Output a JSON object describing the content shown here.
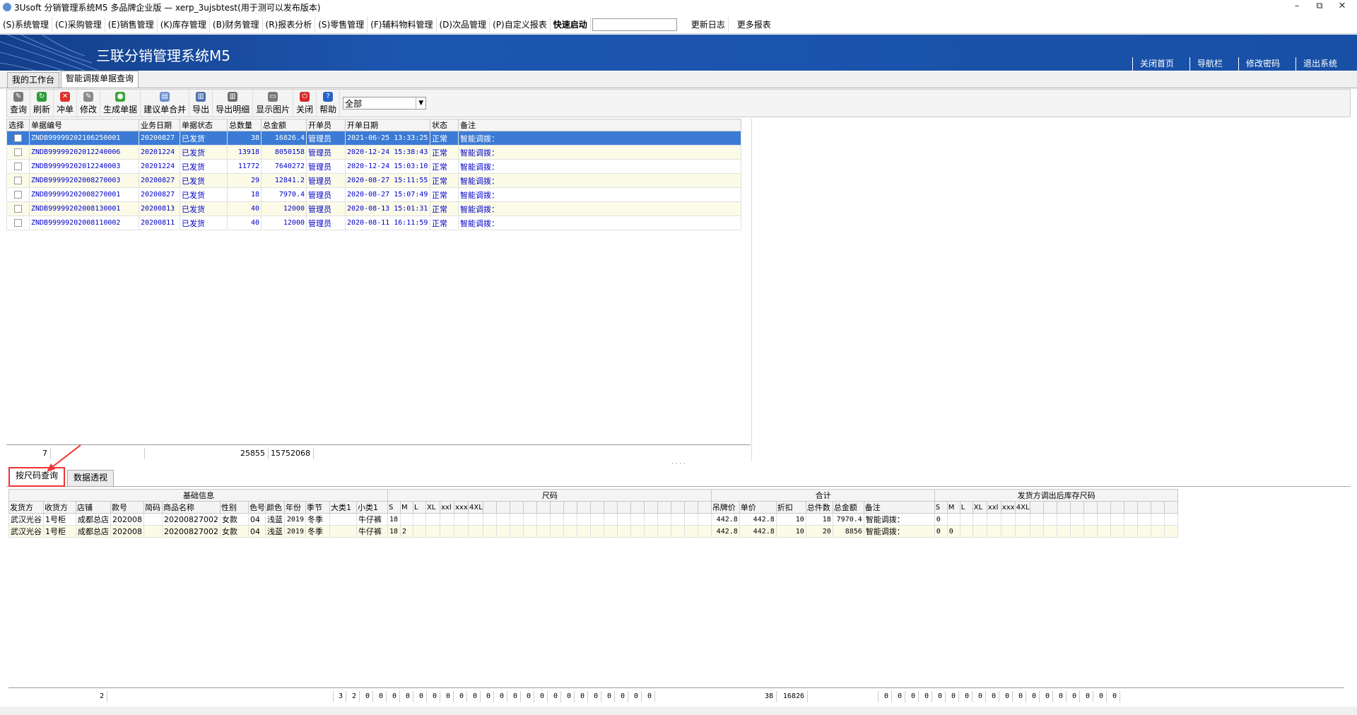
{
  "window": {
    "title": "3Usoft 分销管理系统M5 多品牌企业版 — xerp_3ujsbtest(用于测可以发布版本)",
    "controls": [
      "–",
      "⧉",
      "✕"
    ]
  },
  "menu": {
    "items": [
      "(S)系统管理",
      "(C)采购管理",
      "(E)销售管理",
      "(K)库存管理",
      "(B)财务管理",
      "(R)报表分析",
      "(S)零售管理",
      "(F)辅料物料管理",
      "(D)次品管理",
      "(P)自定义报表"
    ],
    "quick_label": "快速启动",
    "quick_value": "",
    "extra": [
      "更新日志",
      "更多报表"
    ]
  },
  "banner": {
    "title": "三联分销管理系统M5",
    "links": [
      "关闭首页",
      "导航栏",
      "修改密码",
      "退出系统"
    ]
  },
  "tabs": [
    "我的工作台",
    "智能调拨单据查询"
  ],
  "toolbar": {
    "buttons": [
      {
        "label": "查询",
        "icon": "search-icon",
        "color": "#7a7a7a"
      },
      {
        "label": "刷新",
        "icon": "refresh-icon",
        "color": "#2e9a3a"
      },
      {
        "label": "冲单",
        "icon": "cancel-icon",
        "color": "#e0302c"
      },
      {
        "label": "修改",
        "icon": "edit-icon",
        "color": "#8a8a8a"
      },
      {
        "label": "生成单据",
        "icon": "generate-icon",
        "color": "#3aa63a"
      },
      {
        "label": "建议单合并",
        "icon": "merge-icon",
        "color": "#6a8fd0"
      },
      {
        "label": "导出",
        "icon": "export-icon",
        "color": "#4a6fb0"
      },
      {
        "label": "导出明细",
        "icon": "export-detail-icon",
        "color": "#6a6a6a"
      },
      {
        "label": "显示图片",
        "icon": "image-icon",
        "color": "#7a7a7a"
      },
      {
        "label": "关闭",
        "icon": "power-icon",
        "color": "#d82828"
      },
      {
        "label": "帮助",
        "icon": "help-icon",
        "color": "#2a62c8"
      }
    ],
    "filter_value": "全部"
  },
  "grid1": {
    "columns": [
      "选择",
      "单据编号",
      "业务日期",
      "单据状态",
      "总数量",
      "总金额",
      "开单员",
      "开单日期",
      "状态",
      "备注"
    ],
    "rows": [
      [
        "",
        "ZNDB99999202106250001",
        "20200827",
        "已发货",
        "38",
        "16826.4",
        "管理员",
        "2021-06-25 13:33:25",
        "正常",
        "智能调拨："
      ],
      [
        "",
        "ZNDB99999202012240006",
        "20201224",
        "已发货",
        "13918",
        "8050158",
        "管理员",
        "2020-12-24 15:38:43",
        "正常",
        "智能调拨："
      ],
      [
        "",
        "ZNDB99999202012240003",
        "20201224",
        "已发货",
        "11772",
        "7640272",
        "管理员",
        "2020-12-24 15:03:10",
        "正常",
        "智能调拨："
      ],
      [
        "",
        "ZNDB99999202008270003",
        "20200827",
        "已发货",
        "29",
        "12841.2",
        "管理员",
        "2020-08-27 15:11:55",
        "正常",
        "智能调拨："
      ],
      [
        "",
        "ZNDB99999202008270001",
        "20200827",
        "已发货",
        "18",
        "7970.4",
        "管理员",
        "2020-08-27 15:07:49",
        "正常",
        "智能调拨："
      ],
      [
        "",
        "ZNDB99999202008130001",
        "20200813",
        "已发货",
        "40",
        "12000",
        "管理员",
        "2020-08-13 15:01:31",
        "正常",
        "智能调拨："
      ],
      [
        "",
        "ZNDB99999202008110002",
        "20200811",
        "已发货",
        "40",
        "12000",
        "管理员",
        "2020-08-11 16:11:59",
        "正常",
        "智能调拨："
      ]
    ],
    "summary": [
      "7",
      "",
      "25855",
      "15752068"
    ]
  },
  "subtabs": [
    "按尺码查询",
    "数据透视"
  ],
  "grid2": {
    "groups": [
      "基础信息",
      "尺码",
      "合计",
      "发货方调出后库存尺码"
    ],
    "base_columns": [
      "发货方",
      "收货方",
      "店铺",
      "款号",
      "简码",
      "商品名称",
      "性别",
      "色号",
      "颜色",
      "年份",
      "季节",
      "大类1",
      "小类1"
    ],
    "size_columns": [
      "S",
      "M",
      "L",
      "XL",
      "xxl",
      "xxx",
      "4XL"
    ],
    "total_columns": [
      "吊牌价",
      "单价",
      "折扣",
      "总件数",
      "总金额",
      "备注"
    ],
    "stock_columns": [
      "S",
      "M",
      "L",
      "XL",
      "xxl",
      "xxx",
      "4XL"
    ],
    "rows": [
      {
        "base": [
          "武汉光谷",
          "1号柜",
          "成都总店",
          "202008",
          "",
          "20200827002",
          "女款",
          "04",
          "浅蓝",
          "2019",
          "冬季",
          "",
          "牛仔裤"
        ],
        "sizes": [
          "18",
          "",
          "",
          "",
          "",
          "",
          ""
        ],
        "totals": [
          "442.8",
          "442.8",
          "10",
          "18",
          "7970.4",
          "智能调拨："
        ],
        "stock": [
          "0",
          "",
          "",
          "",
          "",
          "",
          ""
        ]
      },
      {
        "base": [
          "武汉光谷",
          "1号柜",
          "成都总店",
          "202008",
          "",
          "20200827002",
          "女款",
          "04",
          "浅蓝",
          "2019",
          "冬季",
          "",
          "牛仔裤"
        ],
        "sizes": [
          "18",
          "2",
          "",
          "",
          "",
          "",
          ""
        ],
        "totals": [
          "442.8",
          "442.8",
          "10",
          "20",
          "8856",
          "智能调拨："
        ],
        "stock": [
          "0",
          "0",
          "",
          "",
          "",
          "",
          ""
        ]
      }
    ],
    "summary": {
      "count": "2",
      "sizes": [
        "3",
        "2",
        "0",
        "0",
        "0",
        "0",
        "0",
        "0",
        "0",
        "0",
        "0",
        "0",
        "0",
        "0",
        "0",
        "0",
        "0",
        "0",
        "0",
        "0",
        "0",
        "0",
        "0",
        "0"
      ],
      "total_qty": "38",
      "total_amount": "16826",
      "stock": [
        "0",
        "0",
        "0",
        "0",
        "0",
        "0",
        "0",
        "0",
        "0",
        "0",
        "0",
        "0",
        "0",
        "0",
        "0",
        "0",
        "0",
        "0"
      ]
    }
  }
}
